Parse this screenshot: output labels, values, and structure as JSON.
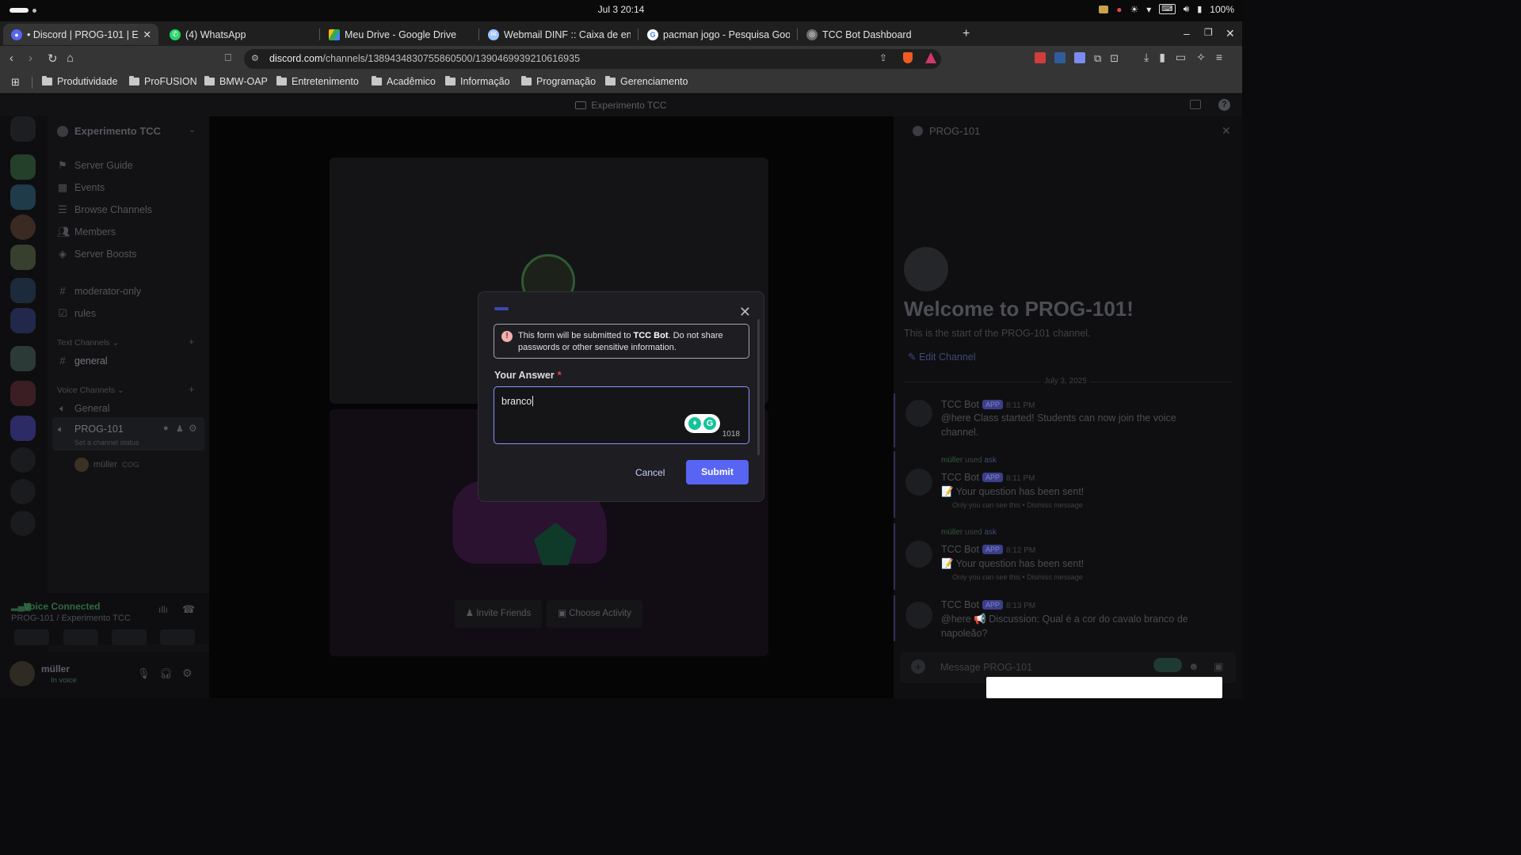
{
  "system": {
    "clock": "Jul 3  20:14",
    "battery": "100%"
  },
  "tabs": [
    {
      "title": "• Discord | PROG-101 | E",
      "active": true
    },
    {
      "title": "(4) WhatsApp"
    },
    {
      "title": "Meu Drive - Google Drive"
    },
    {
      "title": "Webmail DINF :: Caixa de ent"
    },
    {
      "title": "pacman jogo - Pesquisa Goog"
    },
    {
      "title": "TCC Bot Dashboard"
    }
  ],
  "address": {
    "host": "discord.com",
    "path": "/channels/1389434830755860500/1390469939210616935"
  },
  "bookmarks": [
    "Produtividade",
    "ProFUSION",
    "BMW-OAP",
    "Entretenimento",
    "Acadêmico",
    "Informação",
    "Programação",
    "Gerenciamento"
  ],
  "discord": {
    "window_title": "Experimento TCC",
    "server_name": "Experimento TCC",
    "nav": [
      "Server Guide",
      "Events",
      "Browse Channels",
      "Members",
      "Server Boosts"
    ],
    "channels_top": [
      "moderator-only",
      "rules"
    ],
    "text_category": "Text Channels",
    "text_channels": [
      "general"
    ],
    "voice_category": "Voice Channels",
    "voice_channels": [
      "General",
      "PROG-101"
    ],
    "channel_status": "Set a channel status",
    "voice_member": "müller",
    "voice_member_tag": "COG",
    "voice_connected": "Voice Connected",
    "voice_location": "PROG-101 / Experimento TCC",
    "user": {
      "name": "müller",
      "status": "In voice"
    },
    "stage_buttons": {
      "invite": "Invite Friends",
      "activity": "Choose Activity"
    },
    "panel": {
      "channel": "PROG-101",
      "welcome": "Welcome to PROG-101!",
      "start": "This is the start of the PROG-101 channel.",
      "edit": "Edit Channel",
      "date": "July 3, 2025",
      "messages": [
        {
          "author": "TCC Bot",
          "tag": "APP",
          "time": "8:11 PM",
          "text": "@here Class started! Students can now join the voice channel."
        },
        {
          "used_by": "müller",
          "used_cmd": "ask",
          "author": "TCC Bot",
          "tag": "APP",
          "time": "8:11 PM",
          "text": "📝 Your question has been sent!",
          "note": "Only you can see this • Dismiss message"
        },
        {
          "used_by": "müller",
          "used_cmd": "ask",
          "author": "TCC Bot",
          "tag": "APP",
          "time": "8:12 PM",
          "text": "📝 Your question has been sent!",
          "note": "Only you can see this • Dismiss message"
        },
        {
          "author": "TCC Bot",
          "tag": "APP",
          "time": "8:13 PM",
          "text": "@here 📢 Discussion: Qual é a cor do cavalo branco de napoleão?"
        }
      ],
      "composer_placeholder": "Message PROG-101"
    }
  },
  "modal": {
    "warning_prefix": "This form will be submitted to ",
    "warning_bot": "TCC Bot",
    "warning_suffix": ". Do not share passwords or other sensitive information.",
    "field_label": "Your Answer",
    "required_mark": "*",
    "answer_value": "branco",
    "char_count": "1018",
    "cancel_label": "Cancel",
    "submit_label": "Submit"
  }
}
